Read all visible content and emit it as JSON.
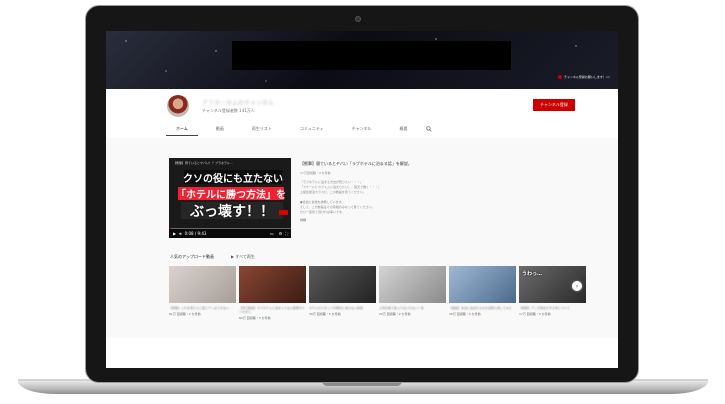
{
  "channel": {
    "name": "アフターホムのチャンネル",
    "subscribers": "チャンネル登録者数 141万人",
    "subscribe_label": "チャンネル登録"
  },
  "banner": {
    "link1": "チャンネル登録お願いします！",
    "link2": "ch"
  },
  "tabs": [
    {
      "label": "ホーム",
      "active": true
    },
    {
      "label": "動画"
    },
    {
      "label": "再生リスト"
    },
    {
      "label": "コミュニティ"
    },
    {
      "label": "チャンネル"
    },
    {
      "label": "概要"
    }
  ],
  "featured": {
    "thumb_line1": "クソの役にも立たない",
    "thumb_line2": "「ホテルに勝つ方法」を",
    "thumb_line3": "ぶっ壊す！！",
    "video_title": "【衝撃】寝ているとヤバい！？ブラホテル…",
    "time": "0:08 / 9:43",
    "progress": 0.02,
    "desc_title": "【衝撃】寝ているとヤバい「ラブホテルに泊まる話」を解説。",
    "desc_meta": "17万回視聴・4 か月前",
    "desc_lines": [
      "「ラブホテルに泊まる方法が知りたい・・・」",
      "「スケールにカブトムシ泊まりたい」、露天で働く・・・」",
      "上級生前泊カラスに、この動画を見てください。",
      "",
      "●合宿に最後を誘発しています。",
      "そして、この動画はその真相のみなって見てください。",
      "ぜひ一度見て頂ければ幸いです。"
    ],
    "more_label": "詳細"
  },
  "shelf": {
    "title": "人気のアップロード動画",
    "play_all": "▶ すべて再生",
    "next_label": "›",
    "videos": [
      {
        "thumb_text": "",
        "title": "【衝撃】これを見たら二度とアレはできない",
        "meta": "61万 回視聴・2 か月前",
        "bg": "#c9c2bd"
      },
      {
        "thumb_text": "",
        "title": "【早口解説】ラブホテルに泊まってみた結果がヤバすぎた",
        "meta": "60万 回視聴・3 か月前",
        "bg": "#7a3d2b"
      },
      {
        "thumb_text": "",
        "title": "ホテルのスタッフが絶対に言わない秘密",
        "meta": "30万 回視聴・5 か月前",
        "bg": "#3a3a3a"
      },
      {
        "thumb_text": "",
        "title": "上司の前で言ってはいけない一言",
        "meta": "22万 回視聴・2 か月前",
        "bg": "#b8b8b8"
      },
      {
        "thumb_text": "",
        "title": "【検証】本当に泊まれるのか実際に試してみた",
        "meta": "18万 回視聴・4 か月前",
        "bg": "#6a8fb5"
      },
      {
        "thumb_text": "うわっ…",
        "title": "【衝撃】アレが残念すぎる件について",
        "meta": "17万 回視聴・3 か月前",
        "bg": "#4c4c4c"
      }
    ]
  }
}
